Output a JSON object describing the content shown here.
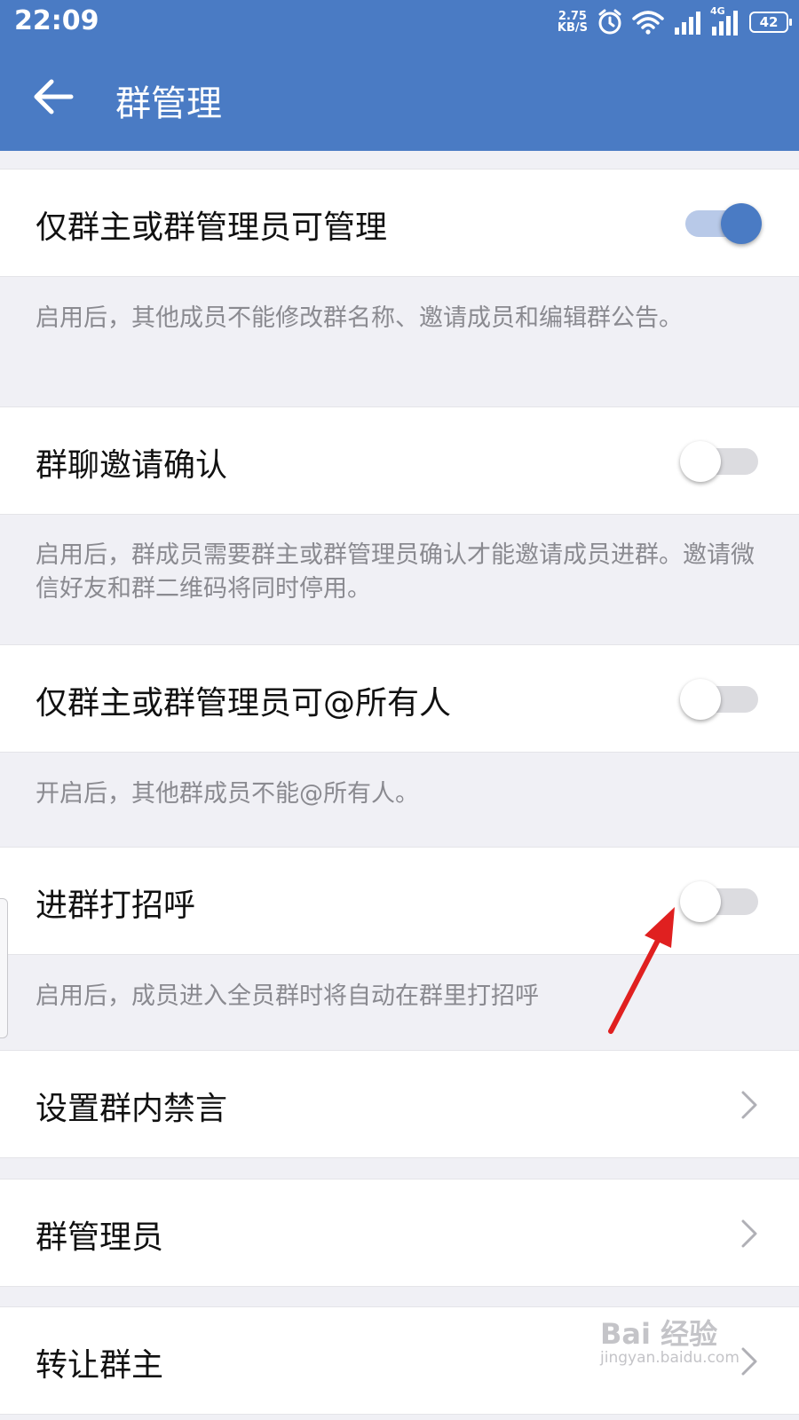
{
  "status_bar": {
    "time": "22:09",
    "net_speed_value": "2.75",
    "net_speed_unit": "KB/S",
    "network_type": "4G",
    "battery": "42",
    "icons": [
      "alarm-icon",
      "wifi-icon",
      "signal-icon",
      "signal-4g-icon"
    ]
  },
  "app_bar": {
    "title": "群管理",
    "back_icon": "arrow-left-icon",
    "background": "#4a7bc4"
  },
  "settings": {
    "owner_admin_manage": {
      "label": "仅群主或群管理员可管理",
      "enabled": true,
      "description": "启用后，其他成员不能修改群名称、邀请成员和编辑群公告。"
    },
    "invite_confirm": {
      "label": "群聊邀请确认",
      "enabled": false,
      "description": "启用后，群成员需要群主或群管理员确认才能邀请成员进群。邀请微信好友和群二维码将同时停用。"
    },
    "mention_all": {
      "label": "仅群主或群管理员可@所有人",
      "enabled": false,
      "description": "开启后，其他群成员不能@所有人。"
    },
    "welcome_greeting": {
      "label": "进群打招呼",
      "enabled": false,
      "description": "启用后，成员进入全员群时将自动在群里打招呼"
    }
  },
  "nav_items": [
    {
      "label": "设置群内禁言"
    },
    {
      "label": "群管理员"
    },
    {
      "label": "转让群主"
    }
  ],
  "annotation": {
    "type": "red-arrow",
    "color": "#e02020"
  },
  "watermark": {
    "main": "Bai  经验",
    "sub": "jingyan.baidu.com"
  },
  "colors": {
    "accent": "#4a7bc4",
    "switch_on_track": "#b8c9e8",
    "switch_off_track": "#dcdce0",
    "background": "#f0f0f5"
  }
}
